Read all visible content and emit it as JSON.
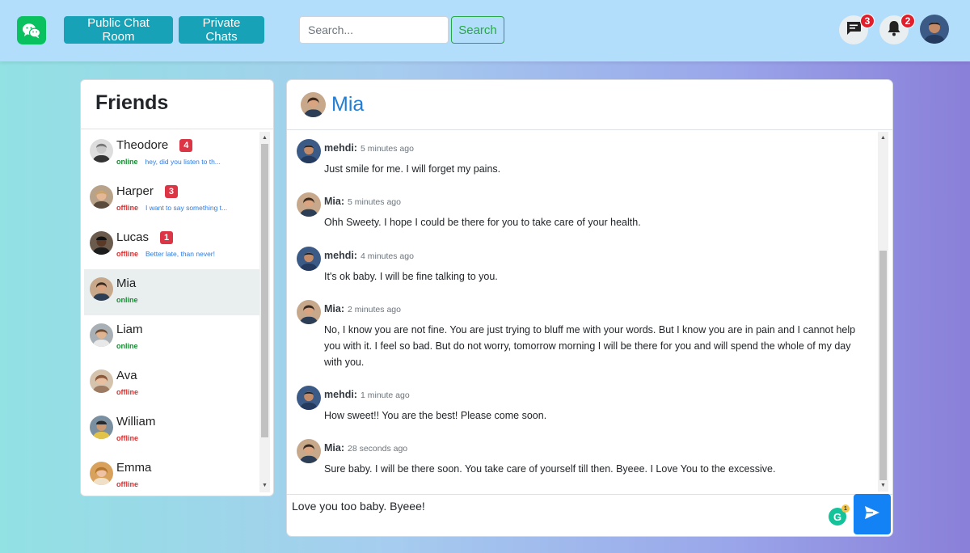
{
  "header": {
    "public_chat_label": "Public Chat Room",
    "private_chats_label": "Private Chats",
    "search_placeholder": "Search...",
    "search_button": "Search",
    "messages_count": "3",
    "notifications_count": "2"
  },
  "friends": {
    "title": "Friends",
    "items": [
      {
        "name": "Theodore",
        "badge": "4",
        "status": "online",
        "last": "hey, did you listen to th..."
      },
      {
        "name": "Harper",
        "badge": "3",
        "status": "offline",
        "last": "I want to say something t..."
      },
      {
        "name": "Lucas",
        "badge": "1",
        "status": "offline",
        "last": "Better late, than never!"
      },
      {
        "name": "Mia",
        "badge": "",
        "status": "online",
        "last": ""
      },
      {
        "name": "Liam",
        "badge": "",
        "status": "online",
        "last": ""
      },
      {
        "name": "Ava",
        "badge": "",
        "status": "offline",
        "last": ""
      },
      {
        "name": "William",
        "badge": "",
        "status": "offline",
        "last": ""
      },
      {
        "name": "Emma",
        "badge": "",
        "status": "offline",
        "last": ""
      }
    ]
  },
  "chat": {
    "name": "Mia",
    "messages": [
      {
        "author": "mehdi:",
        "time": "5 minutes ago",
        "text": "Just smile for me. I will forget my pains."
      },
      {
        "author": "Mia:",
        "time": "5 minutes ago",
        "text": "Ohh Sweety. I hope I could be there for you to take care of your health."
      },
      {
        "author": "mehdi:",
        "time": "4 minutes ago",
        "text": "It's ok baby. I will be fine talking to you."
      },
      {
        "author": "Mia:",
        "time": "2 minutes ago",
        "text": "No, I know you are not fine. You are just trying to bluff me with your words. But I know you are in pain and I cannot help you with it. I feel so bad. But do not worry, tomorrow morning I will be there for you and will spend the whole of my day with you."
      },
      {
        "author": "mehdi:",
        "time": "1 minute ago",
        "text": "How sweet!! You are the best! Please come soon."
      },
      {
        "author": "Mia:",
        "time": "28 seconds ago",
        "text": "Sure baby. I will be there soon. You take care of yourself till then. Byeee. I Love You to the excessive."
      }
    ],
    "composer_text": "Love you too baby. Byeee!",
    "grammarly_count": "1"
  },
  "colors": {
    "accent": "#17a2b8",
    "chat_name": "#1e7ed8",
    "send": "#1382f5",
    "online": "#1a8a35",
    "offline": "#dc2f2f",
    "badge": "#dc3545"
  }
}
